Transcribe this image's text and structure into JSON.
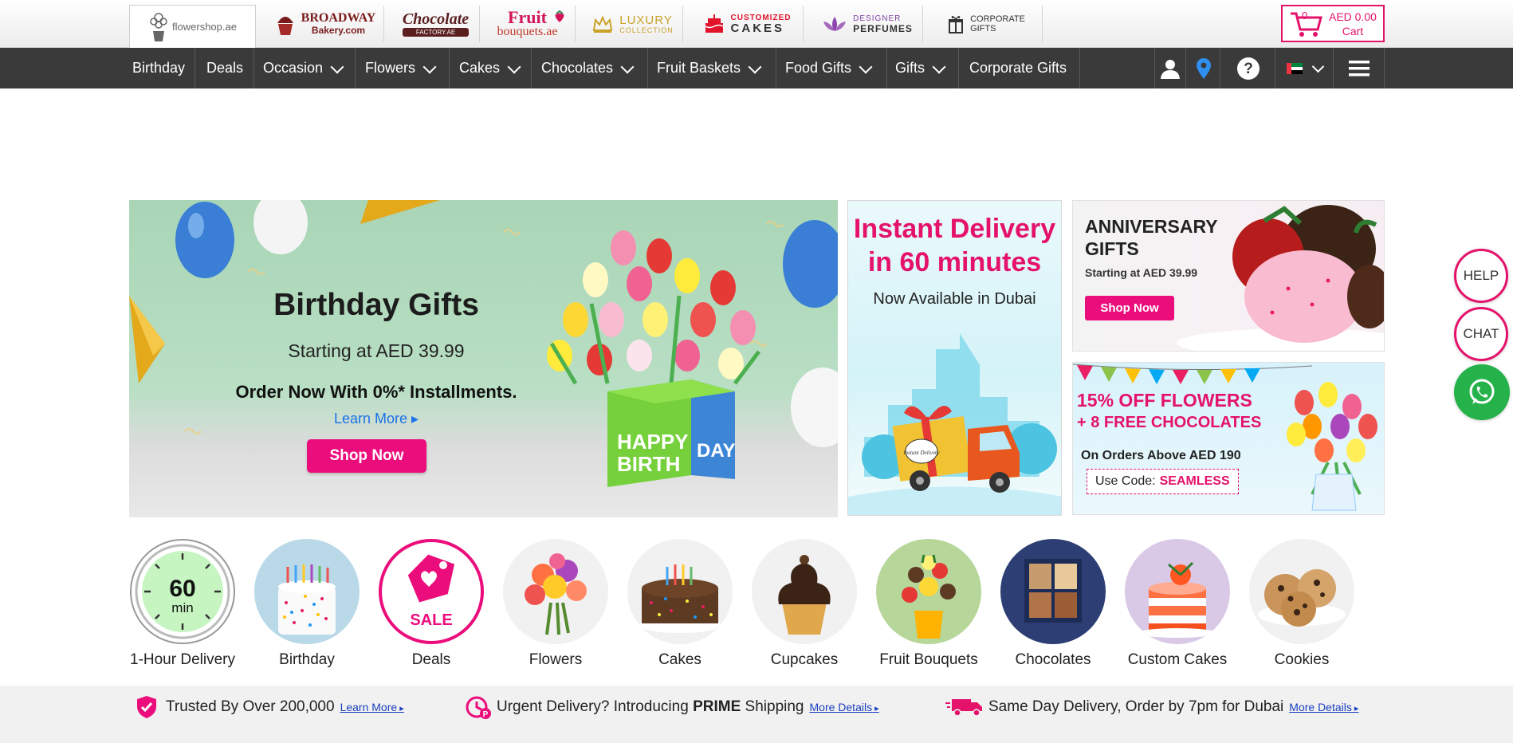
{
  "brands": {
    "flowershop": "flowershop.ae",
    "broadway_1": "BROADWAY",
    "broadway_2": "Bakery.com",
    "chocolate_1": "Chocolate",
    "chocolate_2": "FACTORY.AE",
    "fruit_1": "Fruit",
    "fruit_2": "bouquets.ae",
    "luxury_1": "LUXURY",
    "luxury_2": "COLLECTION",
    "cakes_1": "CUSTOMIZED",
    "cakes_2": "CAKES",
    "perfumes_1": "DESIGNER",
    "perfumes_2": "PERFUMES",
    "corporate_1": "CORPORATE",
    "corporate_2": "GIFTS"
  },
  "cart": {
    "count": "0",
    "amount": "AED 0.00",
    "label": "Cart",
    "accent": "#e4126b"
  },
  "nav": [
    {
      "label": "Birthday"
    },
    {
      "label": "Deals"
    },
    {
      "label": "Occasion"
    },
    {
      "label": "Flowers"
    },
    {
      "label": "Cakes"
    },
    {
      "label": "Chocolates"
    },
    {
      "label": "Fruit Baskets"
    },
    {
      "label": "Food Gifts"
    },
    {
      "label": "Gifts"
    },
    {
      "label": "Corporate Gifts"
    }
  ],
  "nav_icons": [
    "user-icon",
    "location-pin-icon",
    "help-icon",
    "uae-flag-icon",
    "menu-icon"
  ],
  "hero": {
    "title": "Birthday Gifts",
    "subtitle": "Starting at AED 39.99",
    "installments": "Order Now With 0%* Installments.",
    "learn_more": "Learn More ▸",
    "shop_now": "Shop Now",
    "box_text_1": "HAPPY",
    "box_text_2": "BIRTH",
    "box_text_3": "DAY"
  },
  "promo_instant": {
    "line1": "Instant Delivery",
    "line2": "in 60 minutes",
    "line3": "Now Available in Dubai",
    "van_text": "Instant Delivery"
  },
  "promo_anniversary": {
    "title_1": "ANNIVERSARY",
    "title_2": "GIFTS",
    "subtitle": "Starting at AED 39.99",
    "button": "Shop Now"
  },
  "promo_offer": {
    "line1": "15% OFF FLOWERS",
    "line2": "+ 8 FREE CHOCOLATES",
    "line3": "On Orders Above AED 190",
    "code_label": "Use Code:",
    "code": "SEAMLESS"
  },
  "categories": [
    {
      "label": "1-Hour Delivery",
      "clock_num": "60",
      "clock_unit": "min"
    },
    {
      "label": "Birthday"
    },
    {
      "label": "Deals",
      "badge": "SALE"
    },
    {
      "label": "Flowers"
    },
    {
      "label": "Cakes"
    },
    {
      "label": "Cupcakes"
    },
    {
      "label": "Fruit Bouquets"
    },
    {
      "label": "Chocolates"
    },
    {
      "label": "Custom Cakes"
    },
    {
      "label": "Cookies"
    }
  ],
  "side": {
    "help": "HELP",
    "chat": "CHAT"
  },
  "trust": {
    "item1": "Trusted By Over 200,000",
    "item1_link": "Learn More",
    "item2_pre": "Urgent Delivery? Introducing ",
    "item2_bold": "PRIME",
    "item2_post": " Shipping",
    "item2_link": "More Details",
    "item3": "Same Day Delivery, Order by 7pm for Dubai",
    "item3_link": "More Details"
  }
}
